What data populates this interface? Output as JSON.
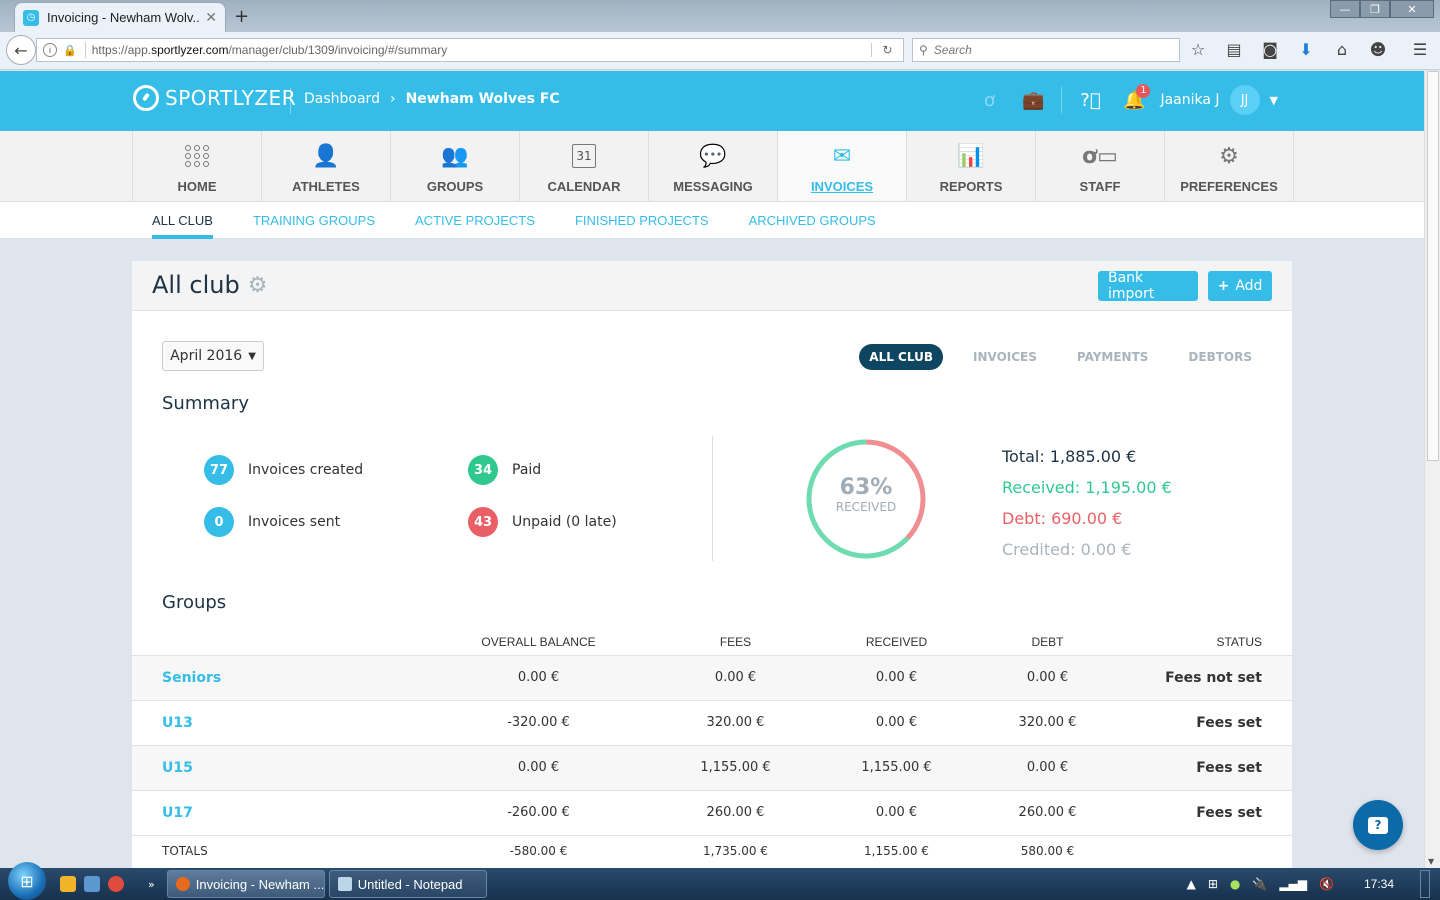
{
  "browser": {
    "tab_title": "Invoicing - Newham Wolv...",
    "url_prefix": "https://app.",
    "url_domain": "sportlyzer.com",
    "url_path": "/manager/club/1309/invoicing/#/summary",
    "search_placeholder": "Search",
    "icons": [
      "bookmark-star-icon",
      "reading-list-icon",
      "pocket-icon",
      "download-icon",
      "home-icon",
      "hello-icon",
      "menu-icon"
    ]
  },
  "header": {
    "brand": "SPORTLYZER",
    "breadcrumb": [
      "Dashboard",
      "Newham Wolves FC"
    ],
    "notifications_count": "1",
    "user_name": "Jaanika J",
    "user_initials": "JJ",
    "colors": {
      "brand": "#35bde8",
      "badge": "#e8565b"
    }
  },
  "main_nav": [
    {
      "label": "HOME",
      "icon": "grid-icon"
    },
    {
      "label": "ATHLETES",
      "icon": "person-icon"
    },
    {
      "label": "GROUPS",
      "icon": "people-icon"
    },
    {
      "label": "CALENDAR",
      "icon": "calendar-icon",
      "icon_text": "31"
    },
    {
      "label": "MESSAGING",
      "icon": "chat-icon"
    },
    {
      "label": "INVOICES",
      "icon": "envelope-dollar-icon",
      "active": true
    },
    {
      "label": "REPORTS",
      "icon": "bar-chart-icon"
    },
    {
      "label": "STAFF",
      "icon": "whistle-briefcase-icon"
    },
    {
      "label": "PREFERENCES",
      "icon": "gear-icon"
    }
  ],
  "sub_nav": [
    {
      "label": "ALL CLUB",
      "active": true
    },
    {
      "label": "TRAINING GROUPS"
    },
    {
      "label": "ACTIVE PROJECTS"
    },
    {
      "label": "FINISHED PROJECTS"
    },
    {
      "label": "ARCHIVED GROUPS"
    }
  ],
  "card": {
    "title": "All club",
    "bank_import_label": "Bank import",
    "add_label": "Add",
    "month": "April 2016",
    "filter_pills": [
      {
        "label": "ALL CLUB",
        "active": true
      },
      {
        "label": "INVOICES"
      },
      {
        "label": "PAYMENTS"
      },
      {
        "label": "DEBTORS"
      }
    ]
  },
  "summary": {
    "title": "Summary",
    "stats": [
      {
        "count": "77",
        "label": "Invoices created",
        "color": "#35bde8"
      },
      {
        "count": "0",
        "label": "Invoices sent",
        "color": "#35bde8"
      },
      {
        "count": "34",
        "label": "Paid",
        "color": "#2fc98f"
      },
      {
        "count": "43",
        "label": "Unpaid (0 late)",
        "color": "#ea5f66"
      }
    ],
    "received_percent": 63,
    "received_percent_label": "63%",
    "received_caption": "RECEIVED",
    "total": "Total: 1,885.00 €",
    "received": "Received: 1,195.00 €",
    "debt": "Debt: 690.00 €",
    "credited": "Credited: 0.00 €",
    "colors": {
      "received": "#2fc98f",
      "debt": "#ea5f66",
      "credited": "#aab4bc",
      "ring_received": "#6fdbb0",
      "ring_debt": "#f08e92"
    }
  },
  "groups": {
    "title": "Groups",
    "columns": [
      "",
      "OVERALL BALANCE",
      "FEES",
      "RECEIVED",
      "DEBT",
      "STATUS"
    ],
    "rows": [
      {
        "name": "Seniors",
        "balance": "0.00 €",
        "fees": "0.00 €",
        "received": "0.00 €",
        "debt": "0.00 €",
        "status": "Fees not set"
      },
      {
        "name": "U13",
        "balance": "-320.00 €",
        "fees": "320.00 €",
        "received": "0.00 €",
        "debt": "320.00 €",
        "status": "Fees set"
      },
      {
        "name": "U15",
        "balance": "0.00 €",
        "fees": "1,155.00 €",
        "received": "1,155.00 €",
        "debt": "0.00 €",
        "status": "Fees set"
      },
      {
        "name": "U17",
        "balance": "-260.00 €",
        "fees": "260.00 €",
        "received": "0.00 €",
        "debt": "260.00 €",
        "status": "Fees set"
      }
    ],
    "totals": {
      "name": "TOTALS",
      "balance": "-580.00 €",
      "fees": "1,735.00 €",
      "received": "1,155.00 €",
      "debt": "580.00 €"
    }
  },
  "taskbar": {
    "tasks": [
      "Invoicing - Newham ...",
      "Untitled - Notepad"
    ],
    "clock": "17:34"
  }
}
